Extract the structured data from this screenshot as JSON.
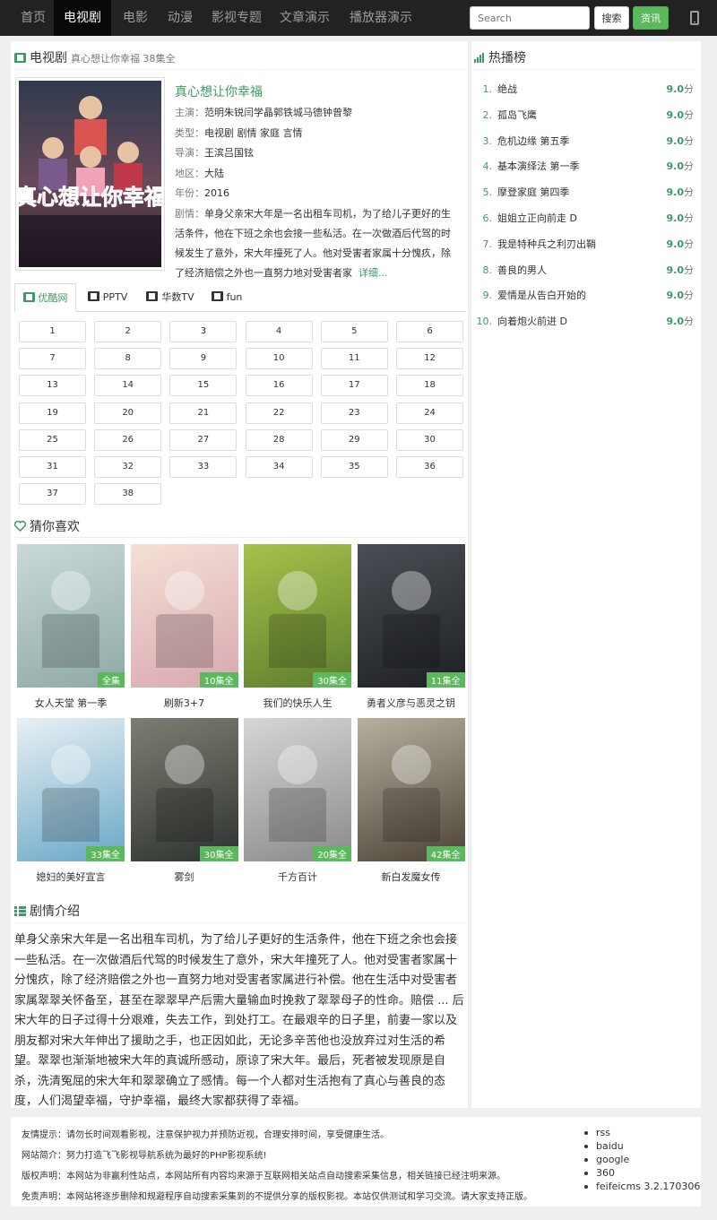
{
  "nav": {
    "items": [
      "首页",
      "电视剧",
      "电影",
      "动漫",
      "影视专题",
      "文章演示",
      "播放器演示"
    ],
    "active_index": 1,
    "search_placeholder": "Search",
    "search_button": "搜索",
    "news_button": "资讯"
  },
  "detail": {
    "section_title": "电视剧",
    "subtitle": "真心想让你幸福 38集全",
    "title": "真心想让你幸福",
    "poster_caption": "真心想让你幸福",
    "cast_label": "主演：",
    "cast": "范明朱锐闫学晶郭铁城马德钟曾黎",
    "genre_label": "类型：",
    "genre": "电视剧 剧情 家庭 言情",
    "director_label": "导演：",
    "director": "王滨吕国铉",
    "region_label": "地区：",
    "region": "大陆",
    "year_label": "年份：",
    "year": "2016",
    "desc_label": "剧情：",
    "desc": "单身父亲宋大年是一名出租车司机，为了给儿子更好的生活条件，他在下班之余也会接一些私活。在一次做酒后代驾的时候发生了意外，宋大年撞死了人。他对受害者家属十分愧疚，除了经济赔偿之外也一直努力地对受害者家",
    "more_label": "详细..."
  },
  "tabs": [
    {
      "label": "优酷网"
    },
    {
      "label": "PPTV"
    },
    {
      "label": "华数TV"
    },
    {
      "label": "fun"
    }
  ],
  "episodes": [
    "1",
    "2",
    "3",
    "4",
    "5",
    "6",
    "7",
    "8",
    "9",
    "10",
    "11",
    "12",
    "13",
    "14",
    "15",
    "16",
    "17",
    "18",
    "19",
    "20",
    "21",
    "22",
    "23",
    "24",
    "25",
    "26",
    "27",
    "28",
    "29",
    "30",
    "31",
    "32",
    "33",
    "34",
    "35",
    "36",
    "37",
    "38"
  ],
  "guess": {
    "title": "猜你喜欢",
    "items": [
      {
        "name": "女人天堂 第一季",
        "badge": "全集",
        "color1": "#c9d9d8",
        "color2": "#8fa9a6"
      },
      {
        "name": "刷新3+7",
        "badge": "10集全",
        "color1": "#f4e0d6",
        "color2": "#d9a8b0"
      },
      {
        "name": "我们的快乐人生",
        "badge": "30集全",
        "color1": "#a7c24a",
        "color2": "#5e7d2e"
      },
      {
        "name": "勇者义彦与恶灵之钥",
        "badge": "11集全",
        "color1": "#4a4f55",
        "color2": "#1e2024"
      },
      {
        "name": "媳妇的美好宣言",
        "badge": "33集全",
        "color1": "#e9f0f4",
        "color2": "#6aa7c7"
      },
      {
        "name": "雾剑",
        "badge": "30集全",
        "color1": "#7b7f72",
        "color2": "#2f3330"
      },
      {
        "name": "千方百计",
        "badge": "20集全",
        "color1": "#d6d6d6",
        "color2": "#8a8a8a"
      },
      {
        "name": "新白发魔女传",
        "badge": "42集全",
        "color1": "#b6b0a0",
        "color2": "#4d4338"
      }
    ]
  },
  "plot": {
    "title": "剧情介绍",
    "text": "单身父亲宋大年是一名出租车司机，为了给儿子更好的生活条件，他在下班之余也会接一些私活。在一次做酒后代驾的时候发生了意外，宋大年撞死了人。他对受害者家属十分愧疚，除了经济赔偿之外也一直努力地对受害者家属进行补偿。他在生活中对受害者家属翠翠关怀备至，甚至在翠翠早产后需大量输血时挽救了翠翠母子的性命。赔偿 ... 后宋大年的日子过得十分艰难，失去工作，到处打工。在最艰辛的日子里，前妻一家以及朋友都对宋大年伸出了援助之手，也正因如此，无论多辛苦他也没放弃过对生活的希望。翠翠也渐渐地被宋大年的真诚所感动，原谅了宋大年。最后，死者被发现原是自杀，洗清冤屈的宋大年和翠翠确立了感情。每一个人都对生活抱有了真心与善良的态度，人们渴望幸福，守护幸福，最终大家都获得了幸福。"
  },
  "ranking": {
    "title": "热播榜",
    "unit": "分",
    "items": [
      {
        "rank": "1.",
        "name": "绝战",
        "score": "9.0"
      },
      {
        "rank": "2.",
        "name": "孤岛飞鹰",
        "score": "9.0"
      },
      {
        "rank": "3.",
        "name": "危机边缘 第五季",
        "score": "9.0"
      },
      {
        "rank": "4.",
        "name": "基本演绎法 第一季",
        "score": "9.0"
      },
      {
        "rank": "5.",
        "name": "摩登家庭 第四季",
        "score": "9.0"
      },
      {
        "rank": "6.",
        "name": "姐姐立正向前走 D",
        "score": "9.0"
      },
      {
        "rank": "7.",
        "name": "我是特种兵之利刃出鞘",
        "score": "9.0"
      },
      {
        "rank": "8.",
        "name": "善良的男人",
        "score": "9.0"
      },
      {
        "rank": "9.",
        "name": "爱情是从告白开始的",
        "score": "9.0"
      },
      {
        "rank": "10.",
        "name": "向着炮火前进 D",
        "score": "9.0"
      }
    ]
  },
  "footer": {
    "lines": [
      "友情提示：请勿长时间观看影视，注意保护视力并预防近视，合理安排时间，享受健康生活。",
      "网站简介：努力打造飞飞影视导航系统为最好的PHP影视系统!",
      "版权声明：本网站为非赢利性站点，本网站所有内容均来源于互联网相关站点自动搜索采集信息，相关链接已经注明来源。",
      "免责声明：本网站将逐步删除和规避程序自动搜索采集到的不提供分享的版权影视。本站仅供测试和学习交流。请大家支持正版。"
    ],
    "links": [
      "rss",
      "baidu",
      "google",
      "360",
      "feifeicms 3.2.170306"
    ]
  }
}
